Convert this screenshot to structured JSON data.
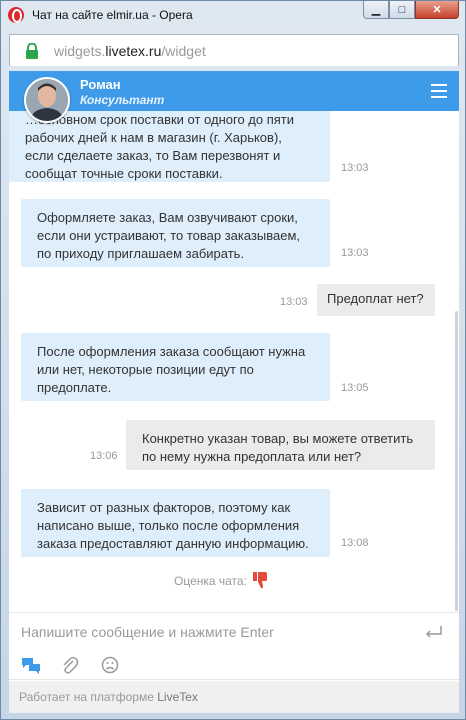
{
  "window": {
    "title": "Чат на сайте elmir.ua - Opera",
    "minimize": "▁",
    "maximize": "□",
    "close": "✕"
  },
  "address": {
    "url_prefix": "widgets.",
    "url_domain": "livetex.ru",
    "url_path": "/widget"
  },
  "header": {
    "operator_name": "Роман",
    "operator_role": "Консультант"
  },
  "messages": [
    {
      "dir": "in",
      "text": "…основном срок поставки от одного до пяти рабочих дней к нам в магазин (г. Харьков), если сделаете заказ, то Вам перезвонят и сообщат точные сроки поставки.",
      "time": "13:03"
    },
    {
      "dir": "in",
      "text": "Оформляете заказ, Вам озвучивают сроки, если они устраивают, то товар заказываем, по приходу приглашаем забирать.",
      "time": "13:03"
    },
    {
      "dir": "out",
      "text": "Предоплат нет?",
      "time": "13:03"
    },
    {
      "dir": "in",
      "text": "После оформления заказа сообщают нужна или нет, некоторые позиции едут по предоплате.",
      "time": "13:05"
    },
    {
      "dir": "out",
      "text": "Конкретно указан товар, вы можете ответить по нему нужна предоплата или нет?",
      "time": "13:06"
    },
    {
      "dir": "in",
      "text": "Зависит от разных факторов, поэтому как написано выше, только после оформления заказа предоставляют данную информацию.",
      "time": "13:08"
    }
  ],
  "rating": {
    "label": "Оценка чата:",
    "icon": "thumbs-down-icon",
    "color": "#e34a3a"
  },
  "composer": {
    "placeholder": "Напишите сообщение и нажмите Enter"
  },
  "footer": {
    "prefix": "Работает на платформе",
    "brand": "LiveTex"
  },
  "colors": {
    "accent": "#3d9be9",
    "incoming_bubble": "#dfeefb",
    "outgoing_bubble": "#ebebeb"
  }
}
